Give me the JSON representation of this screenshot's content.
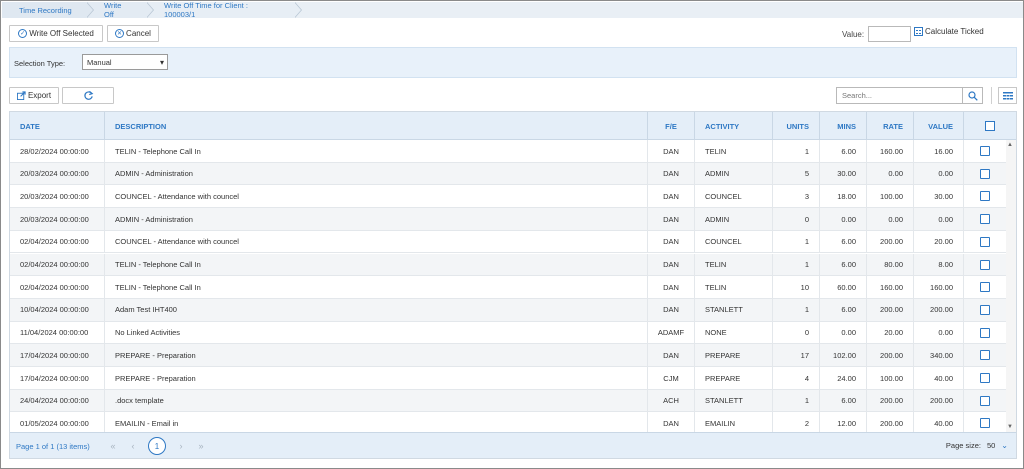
{
  "breadcrumb": [
    "Time Recording",
    "Write Off",
    "Write Off Time for Client : 100003/1"
  ],
  "toolbar": {
    "write_off_label": "Write Off Selected",
    "cancel_label": "Cancel",
    "value_label": "Value:",
    "value_input": "",
    "calculate_label": "Calculate Ticked"
  },
  "selection": {
    "label": "Selection Type:",
    "selected": "Manual"
  },
  "grid_toolbar": {
    "export_label": "Export",
    "search_placeholder": "Search..."
  },
  "columns": {
    "date": "DATE",
    "description": "DESCRIPTION",
    "fe": "F/E",
    "activity": "ACTIVITY",
    "units": "UNITS",
    "mins": "MINS",
    "rate": "RATE",
    "value": "VALUE"
  },
  "rows": [
    {
      "date": "28/02/2024 00:00:00",
      "description": "TELIN - Telephone Call In",
      "fe": "DAN",
      "activity": "TELIN",
      "units": "1",
      "mins": "6.00",
      "rate": "160.00",
      "value": "16.00"
    },
    {
      "date": "20/03/2024 00:00:00",
      "description": "ADMIN - Administration",
      "fe": "DAN",
      "activity": "ADMIN",
      "units": "5",
      "mins": "30.00",
      "rate": "0.00",
      "value": "0.00"
    },
    {
      "date": "20/03/2024 00:00:00",
      "description": "COUNCEL - Attendance with councel",
      "fe": "DAN",
      "activity": "COUNCEL",
      "units": "3",
      "mins": "18.00",
      "rate": "100.00",
      "value": "30.00"
    },
    {
      "date": "20/03/2024 00:00:00",
      "description": "ADMIN - Administration",
      "fe": "DAN",
      "activity": "ADMIN",
      "units": "0",
      "mins": "0.00",
      "rate": "0.00",
      "value": "0.00"
    },
    {
      "date": "02/04/2024 00:00:00",
      "description": "COUNCEL - Attendance with councel",
      "fe": "DAN",
      "activity": "COUNCEL",
      "units": "1",
      "mins": "6.00",
      "rate": "200.00",
      "value": "20.00"
    },
    {
      "date": "02/04/2024 00:00:00",
      "description": "TELIN - Telephone Call In",
      "fe": "DAN",
      "activity": "TELIN",
      "units": "1",
      "mins": "6.00",
      "rate": "80.00",
      "value": "8.00"
    },
    {
      "date": "02/04/2024 00:00:00",
      "description": "TELIN - Telephone Call In",
      "fe": "DAN",
      "activity": "TELIN",
      "units": "10",
      "mins": "60.00",
      "rate": "160.00",
      "value": "160.00"
    },
    {
      "date": "10/04/2024 00:00:00",
      "description": "Adam Test IHT400",
      "fe": "DAN",
      "activity": "STANLETT",
      "units": "1",
      "mins": "6.00",
      "rate": "200.00",
      "value": "200.00"
    },
    {
      "date": "11/04/2024 00:00:00",
      "description": "No Linked Activities",
      "fe": "ADAMF",
      "activity": "NONE",
      "units": "0",
      "mins": "0.00",
      "rate": "20.00",
      "value": "0.00"
    },
    {
      "date": "17/04/2024 00:00:00",
      "description": "PREPARE - Preparation",
      "fe": "DAN",
      "activity": "PREPARE",
      "units": "17",
      "mins": "102.00",
      "rate": "200.00",
      "value": "340.00"
    },
    {
      "date": "17/04/2024 00:00:00",
      "description": "PREPARE - Preparation",
      "fe": "CJM",
      "activity": "PREPARE",
      "units": "4",
      "mins": "24.00",
      "rate": "100.00",
      "value": "40.00"
    },
    {
      "date": "24/04/2024 00:00:00",
      "description": ".docx template",
      "fe": "ACH",
      "activity": "STANLETT",
      "units": "1",
      "mins": "6.00",
      "rate": "200.00",
      "value": "200.00"
    },
    {
      "date": "01/05/2024 00:00:00",
      "description": "EMAILIN - Email in",
      "fe": "DAN",
      "activity": "EMAILIN",
      "units": "2",
      "mins": "12.00",
      "rate": "200.00",
      "value": "40.00"
    }
  ],
  "footer": {
    "page_info": "Page 1 of 1 (13 items)",
    "current_page": "1",
    "page_size_label": "Page size:",
    "page_size": "50"
  },
  "colors": {
    "accent": "#2e78c4",
    "header_bg": "#e4eef8",
    "selection_bg": "#e8f1fa"
  }
}
